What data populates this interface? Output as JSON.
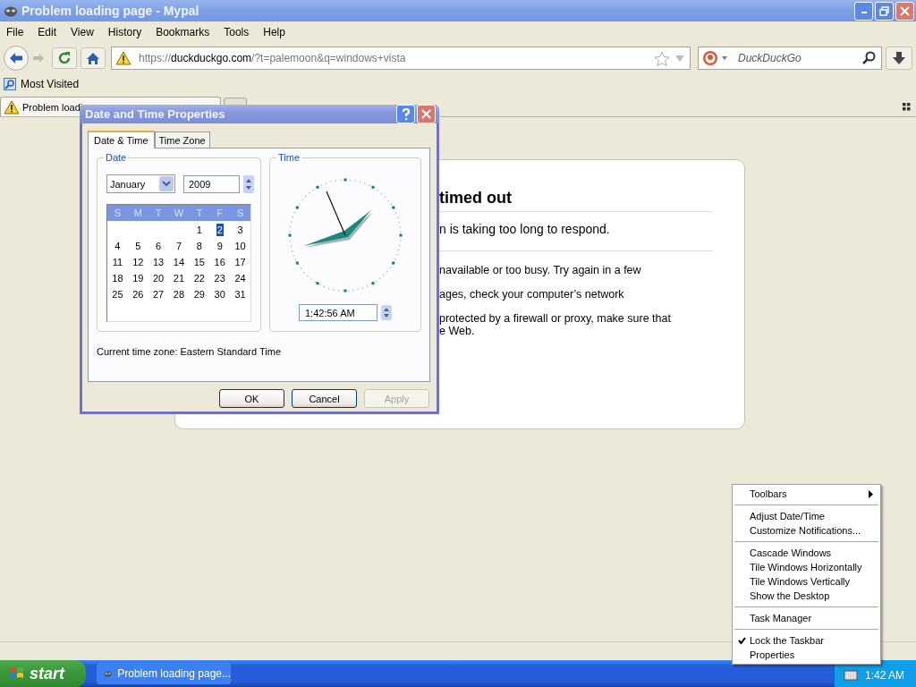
{
  "window": {
    "title": "Problem loading page - Mypal"
  },
  "menu_bar": [
    "File",
    "Edit",
    "View",
    "History",
    "Bookmarks",
    "Tools",
    "Help"
  ],
  "nav_buttons": [
    {
      "kind": "back",
      "disabled": false
    },
    {
      "kind": "forward",
      "disabled": true
    },
    {
      "kind": "reload",
      "disabled": false
    },
    {
      "kind": "home",
      "disabled": false
    }
  ],
  "address_bar": {
    "scheme": "https://",
    "host": "duckduckgo.com",
    "path": "/?t=palemoon&q=windows+vista"
  },
  "search": {
    "placeholder": "DuckDuckGo"
  },
  "bookmarks_bar": [
    "Most Visited"
  ],
  "tabs": [
    {
      "label": "Problem loadi",
      "selected": true
    }
  ],
  "error_page": {
    "heading": "timed out",
    "summary": "n is taking too long to respond.",
    "lines": [
      "navailable or too busy. Try again in a few",
      "ages, check your computer’s network",
      "protected by a firewall or proxy, make sure that\ne Web."
    ]
  },
  "dialog": {
    "title": "Date and Time Properties",
    "tabs": [
      {
        "label": "Date & Time",
        "selected": true
      },
      {
        "label": "Time Zone",
        "selected": false
      }
    ],
    "date_group": "Date",
    "month": "January",
    "year": "2009",
    "weekdays": [
      "S",
      "M",
      "T",
      "W",
      "T",
      "F",
      "S"
    ],
    "weeks": [
      [
        {
          "label": "1",
          "selected": false
        },
        {
          "label": "2",
          "selected": true
        },
        {
          "label": "3",
          "selected": false
        }
      ],
      [
        {
          "label": "4",
          "selected": false
        },
        {
          "label": "5",
          "selected": false
        },
        {
          "label": "6",
          "selected": false
        },
        {
          "label": "7",
          "selected": false
        },
        {
          "label": "8",
          "selected": false
        },
        {
          "label": "9",
          "selected": false
        },
        {
          "label": "10",
          "selected": false
        }
      ],
      [
        {
          "label": "11",
          "selected": false
        },
        {
          "label": "12",
          "selected": false
        },
        {
          "label": "13",
          "selected": false
        },
        {
          "label": "14",
          "selected": false
        },
        {
          "label": "15",
          "selected": false
        },
        {
          "label": "16",
          "selected": false
        },
        {
          "label": "17",
          "selected": false
        }
      ],
      [
        {
          "label": "18",
          "selected": false
        },
        {
          "label": "19",
          "selected": false
        },
        {
          "label": "20",
          "selected": false
        },
        {
          "label": "21",
          "selected": false
        },
        {
          "label": "22",
          "selected": false
        },
        {
          "label": "23",
          "selected": false
        },
        {
          "label": "24",
          "selected": false
        }
      ],
      [
        {
          "label": "25",
          "selected": false
        },
        {
          "label": "26",
          "selected": false
        },
        {
          "label": "27",
          "selected": false
        },
        {
          "label": "28",
          "selected": false
        },
        {
          "label": "29",
          "selected": false
        },
        {
          "label": "30",
          "selected": false
        },
        {
          "label": "31",
          "selected": false
        }
      ]
    ],
    "time_group": "Time",
    "time": "1:42:56 AM",
    "timezone": "Current time zone:  Eastern Standard Time",
    "buttons": [
      {
        "label": "OK",
        "disabled": false
      },
      {
        "label": "Cancel",
        "disabled": false
      },
      {
        "label": "Apply",
        "disabled": true
      }
    ]
  },
  "context_menu": {
    "groups": [
      [
        {
          "label": "Toolbars",
          "submenu": true,
          "checked": false
        }
      ],
      [
        {
          "label": "Adjust Date/Time",
          "submenu": false,
          "checked": false
        },
        {
          "label": "Customize Notifications...",
          "submenu": false,
          "checked": false
        }
      ],
      [
        {
          "label": "Cascade Windows",
          "submenu": false,
          "checked": false
        },
        {
          "label": "Tile Windows Horizontally",
          "submenu": false,
          "checked": false
        },
        {
          "label": "Tile Windows Vertically",
          "submenu": false,
          "checked": false
        },
        {
          "label": "Show the Desktop",
          "submenu": false,
          "checked": false
        }
      ],
      [
        {
          "label": "Task Manager",
          "submenu": false,
          "checked": false
        }
      ],
      [
        {
          "label": "Lock the Taskbar",
          "submenu": false,
          "checked": true
        },
        {
          "label": "Properties",
          "submenu": false,
          "checked": false
        }
      ]
    ]
  },
  "taskbar": {
    "start": "start",
    "tasks": [
      {
        "label": "Problem loading page...",
        "selected": false
      }
    ],
    "clock": "1:42 AM"
  }
}
